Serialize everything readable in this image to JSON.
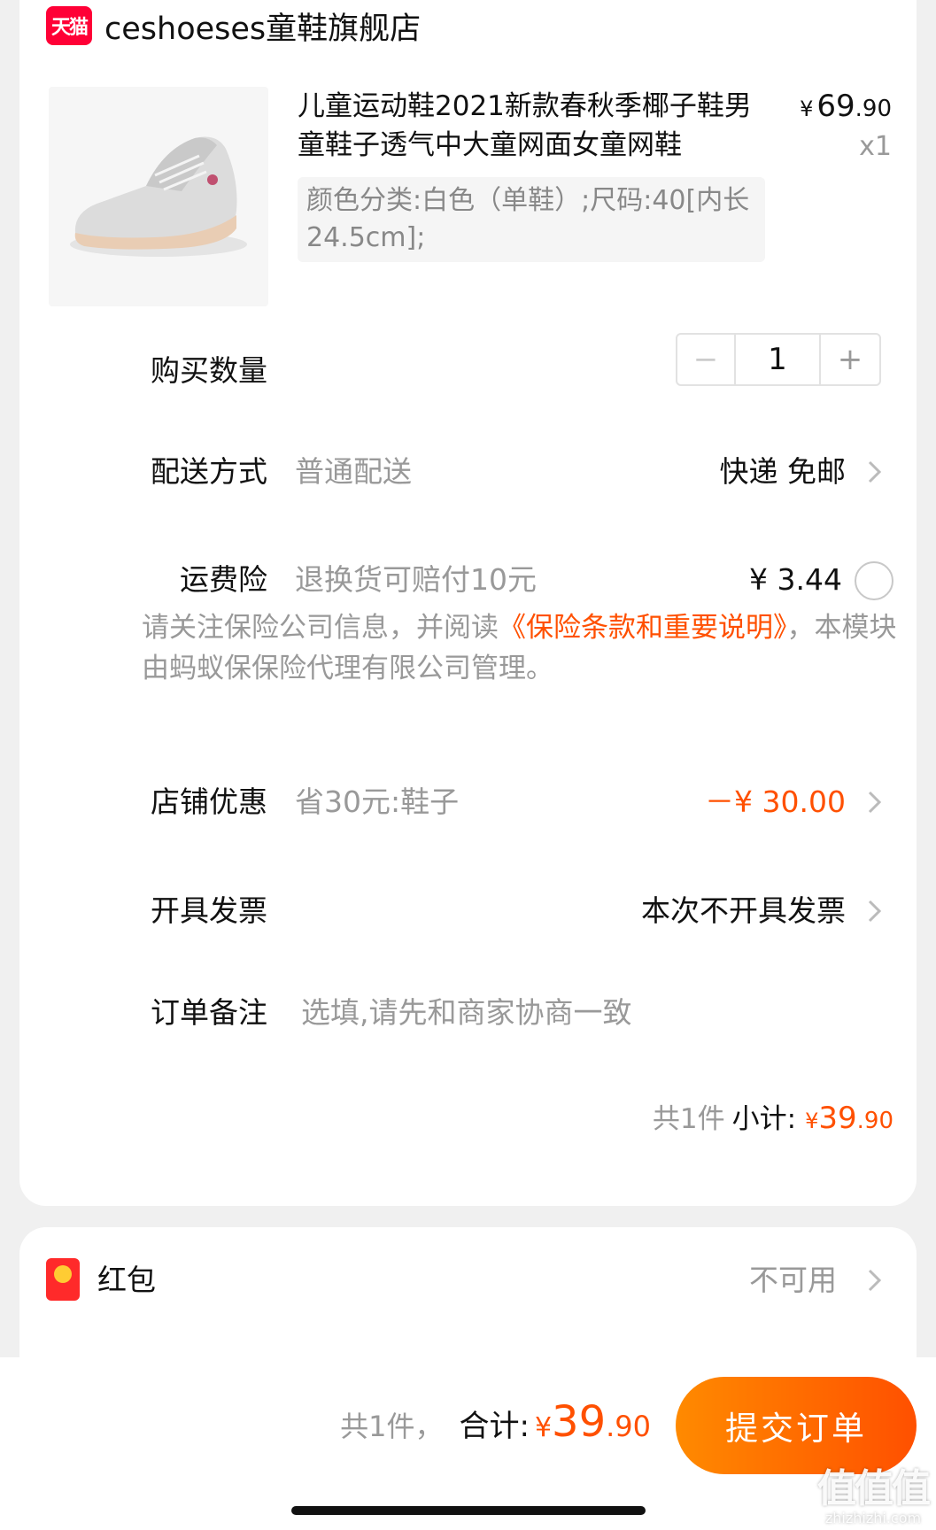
{
  "store": {
    "logo_text": "天猫",
    "name": "ceshoeses童鞋旗舰店"
  },
  "product": {
    "title": "儿童运动鞋2021新款春秋季椰子鞋男童鞋子透气中大童网面女童网鞋",
    "sku": "颜色分类:白色（单鞋）;尺码:40[内长24.5cm];",
    "price_yen": "¥",
    "price_int": "69",
    "price_dec": ".90",
    "qty_text": "x1"
  },
  "quantity": {
    "label": "购买数量",
    "minus": "−",
    "value": "1",
    "plus": "+"
  },
  "delivery": {
    "label": "配送方式",
    "method": "普通配送",
    "value": "快递 免邮"
  },
  "insurance": {
    "label": "运费险",
    "desc": "退换货可赔付10元",
    "price": "¥ 3.44",
    "note_prefix": "请关注保险公司信息，并阅读",
    "note_link": "《保险条款和重要说明》",
    "note_suffix": "，本模块由蚂蚁保保险代理有限公司管理。"
  },
  "store_discount": {
    "label": "店铺优惠",
    "desc": "省30元:鞋子",
    "value": "－¥ 30.00"
  },
  "invoice": {
    "label": "开具发票",
    "value": "本次不开具发票"
  },
  "remark": {
    "label": "订单备注",
    "placeholder": "选填,请先和商家协商一致"
  },
  "subtotal": {
    "count": "共1件",
    "label": "小计:",
    "yen": "¥",
    "int": "39",
    "dec": ".90"
  },
  "red_packet": {
    "label": "红包",
    "status": "不可用"
  },
  "footer": {
    "count": "共1件，",
    "label": "合计:",
    "yen": "¥",
    "int": "39",
    "dec": ".90",
    "submit_label": "提交订单"
  },
  "watermark": {
    "big": "值值值",
    "small": "zhizhizhi.com"
  },
  "colors": {
    "accent": "#ff5000",
    "button_start": "#ff8a00",
    "button_end": "#ff5000",
    "tmall_red": "#ff0036"
  },
  "icons": [
    "chevron-right-icon",
    "radio-unchecked-icon",
    "red-packet-icon",
    "tmall-logo-icon"
  ]
}
